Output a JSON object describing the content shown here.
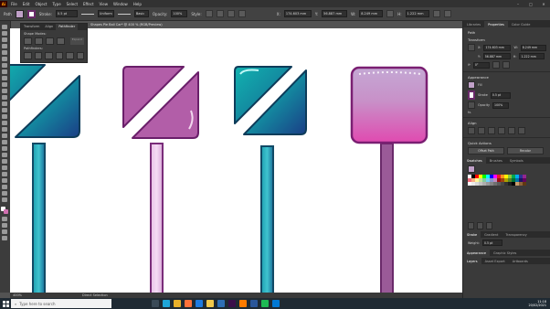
{
  "menubar": {
    "logo": "Ai",
    "items": [
      "File",
      "Edit",
      "Object",
      "Type",
      "Select",
      "Effect",
      "View",
      "Window",
      "Help"
    ]
  },
  "controlbar": {
    "selection_label": "Path",
    "stroke_label": "Stroke:",
    "stroke_value": "0.5 pt",
    "uniform_label": "Uniform",
    "basic_label": "Basic",
    "opacity_label": "Opacity:",
    "opacity_value": "100%",
    "style_label": "Style:",
    "x_value": "174.603 mm",
    "y_value": "56.887 mm",
    "w_value": "8.249 mm",
    "h_value": "1.222 mm",
    "fill_color": "#c0a0c8",
    "stroke_color": "#6a2a6a"
  },
  "doctab": {
    "title": "Shapes Pie Ball Car* @ 400 % (RGB/Preview)"
  },
  "pathfinder": {
    "tabs": [
      "Transform",
      "Align",
      "Pathfinder"
    ],
    "active_tab": "Pathfinder",
    "shape_modes_label": "Shape Modes:",
    "pathfinders_label": "Pathfinders:",
    "expand_label": "Expand"
  },
  "statusbar": {
    "zoom": "400%",
    "tool": "Direct Selection"
  },
  "rightpanel": {
    "tabs": [
      "Libraries",
      "Properties",
      "Color Guide"
    ],
    "active_tab": "Properties",
    "selection_type": "Path",
    "transform_heading": "Transform",
    "x_value": "174.603 mm",
    "y_value": "56.887 mm",
    "w_value": "8.249 mm",
    "h_value": "1.222 mm",
    "angle_value": "0°",
    "appearance_heading": "Appearance",
    "fill_label": "Fill",
    "stroke_label": "Stroke",
    "stroke_value": "0.5 pt",
    "opacity_label": "Opacity",
    "opacity_value": "100%",
    "fx_label": "fx.",
    "align_heading": "Align",
    "quick_actions_heading": "Quick Actions",
    "offset_path_label": "Offset Path",
    "recolor_label": "Recolor",
    "swatches_tabs": [
      "Swatches",
      "Brushes",
      "Symbols"
    ],
    "stroke_tabs": [
      "Stroke",
      "Gradient",
      "Transparency"
    ],
    "weight_label": "Weight:",
    "weight_value": "0.5 pt",
    "appearance_tabs": [
      "Appearance",
      "Graphic Styles"
    ],
    "layers_tabs": [
      "Layers",
      "Asset Export",
      "Artboards"
    ],
    "swatch_colors": [
      "#ffffff",
      "#000000",
      "#ff0000",
      "#ffff00",
      "#00ff00",
      "#00ffff",
      "#0000ff",
      "#ff00ff",
      "#ed1c24",
      "#f7941d",
      "#fff200",
      "#8dc63f",
      "#00a651",
      "#00aeef",
      "#2e3192",
      "#92278f",
      "#f26d7d",
      "#f9ad81",
      "#fff799",
      "#c4df9b",
      "#82ca9c",
      "#6dcff6",
      "#8493ca",
      "#bd8cbf",
      "#9e0b0f",
      "#a0410d",
      "#aba000",
      "#598527",
      "#007236",
      "#0076a3",
      "#1b1464",
      "#630460",
      "#ffffff",
      "#ebebeb",
      "#d7d7d7",
      "#c2c2c2",
      "#aeaeae",
      "#999999",
      "#858585",
      "#707070",
      "#5c5c5c",
      "#474747",
      "#333333",
      "#1e1e1e",
      "#000000",
      "#c69c6d",
      "#8c6239",
      "#603913"
    ]
  },
  "taskbar": {
    "search_placeholder": "Type here to search",
    "time": "11:18",
    "date": "20/02/2021",
    "apps": [
      {
        "name": "task-view",
        "color": "#3a4a57"
      },
      {
        "name": "edge",
        "color": "#1ea5d8"
      },
      {
        "name": "chrome",
        "color": "#e8b02a"
      },
      {
        "name": "firefox",
        "color": "#ff7139"
      },
      {
        "name": "store",
        "color": "#1f7be0"
      },
      {
        "name": "file-explorer",
        "color": "#f2c94c"
      },
      {
        "name": "photos",
        "color": "#2f6fb5"
      },
      {
        "name": "premiere",
        "color": "#3a0f4a"
      },
      {
        "name": "illustrator",
        "color": "#ff7c00"
      },
      {
        "name": "word",
        "color": "#2b579a"
      },
      {
        "name": "spotify",
        "color": "#1db954"
      },
      {
        "name": "mail",
        "color": "#0078d4"
      }
    ]
  }
}
